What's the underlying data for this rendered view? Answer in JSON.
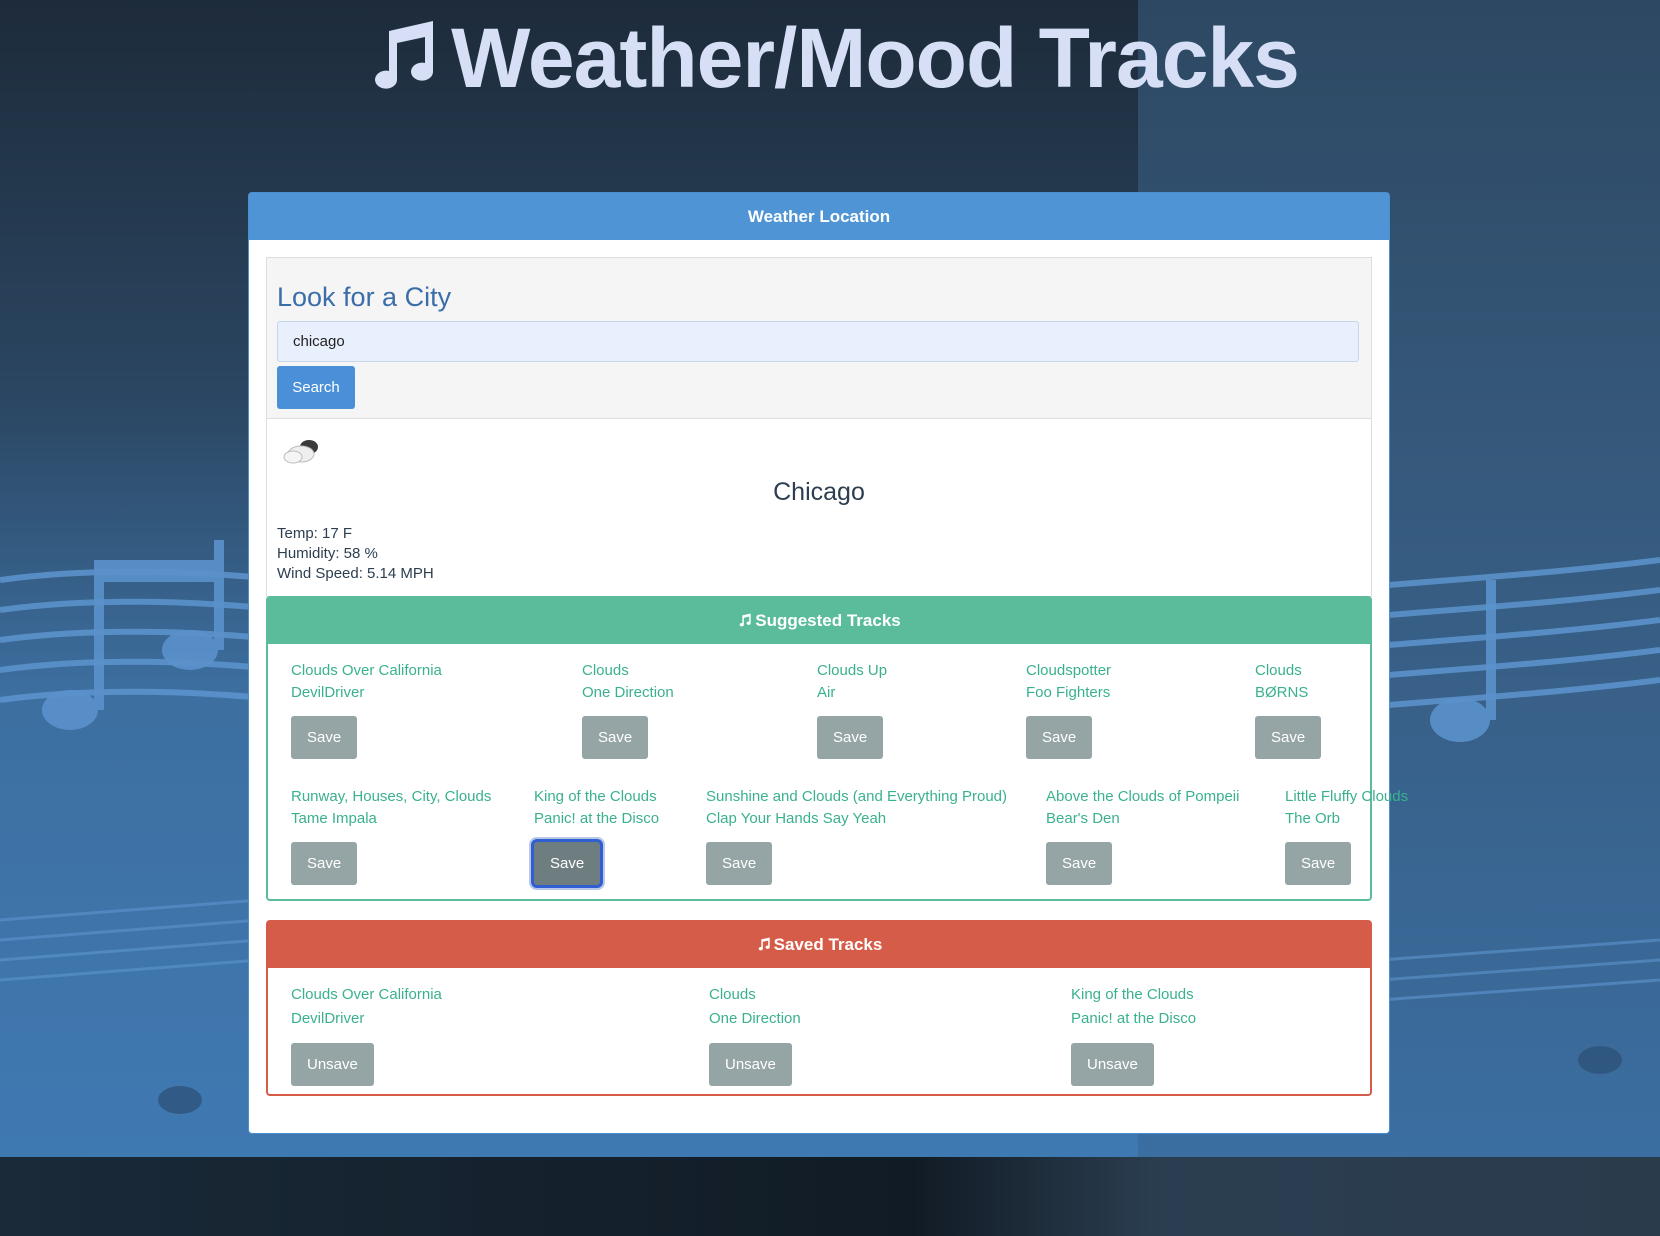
{
  "app": {
    "title": "Weather/Mood Tracks"
  },
  "weather_panel": {
    "header": "Weather Location"
  },
  "search": {
    "title": "Look for a City",
    "input_value": "chicago",
    "button_label": "Search"
  },
  "weather": {
    "icon": "cloudy-icon",
    "city": "Chicago",
    "temp": "Temp: 17 F",
    "humidity": "Humidity: 58 %",
    "wind": "Wind Speed: 5.14 MPH"
  },
  "suggested": {
    "header": "Suggested Tracks",
    "tracks": [
      {
        "title": "Clouds Over California",
        "artist": "DevilDriver",
        "button": "Save"
      },
      {
        "title": "Clouds",
        "artist": "One Direction",
        "button": "Save"
      },
      {
        "title": "Clouds Up",
        "artist": "Air",
        "button": "Save"
      },
      {
        "title": "Cloudspotter",
        "artist": "Foo Fighters",
        "button": "Save"
      },
      {
        "title": "Clouds",
        "artist": "BØRNS",
        "button": "Save"
      },
      {
        "title": "Runway, Houses, City, Clouds",
        "artist": "Tame Impala",
        "button": "Save"
      },
      {
        "title": "King of the Clouds",
        "artist": "Panic! at the Disco",
        "button": "Save"
      },
      {
        "title": "Sunshine and Clouds (and Everything Proud)",
        "artist": "Clap Your Hands Say Yeah",
        "button": "Save"
      },
      {
        "title": "Above the Clouds of Pompeii",
        "artist": "Bear's Den",
        "button": "Save"
      },
      {
        "title": "Little Fluffy Clouds",
        "artist": "The Orb",
        "button": "Save"
      }
    ]
  },
  "saved": {
    "header": "Saved Tracks",
    "tracks": [
      {
        "title": "Clouds Over California",
        "artist": "DevilDriver",
        "button": "Unsave"
      },
      {
        "title": "Clouds",
        "artist": "One Direction",
        "button": "Unsave"
      },
      {
        "title": "King of the Clouds",
        "artist": "Panic! at the Disco",
        "button": "Unsave"
      }
    ]
  },
  "colors": {
    "header_blue": "#4f95d5",
    "suggested_green": "#5bbc9c",
    "saved_red": "#d65c4a",
    "button_gray": "#95a5a6",
    "track_text": "#3ab18e"
  }
}
